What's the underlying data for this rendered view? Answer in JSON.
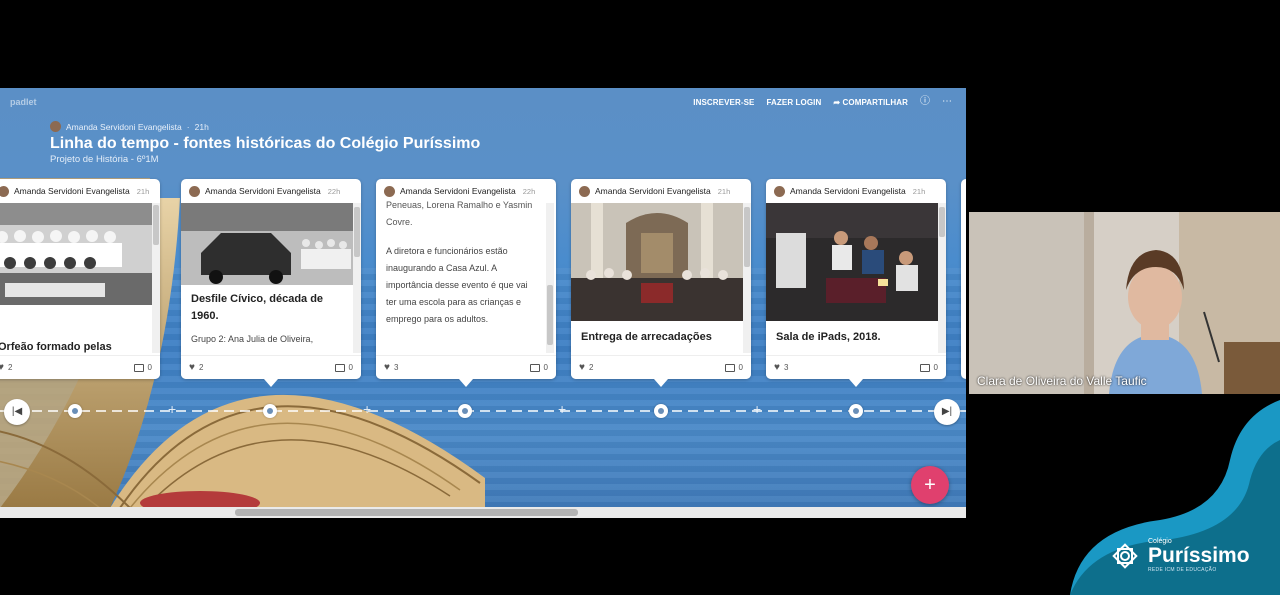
{
  "padlet": {
    "logo": "padlet",
    "nav": {
      "signup": "INSCREVER-SE",
      "login": "FAZER LOGIN",
      "share": "COMPARTILHAR"
    },
    "author": "Amanda Servidoni Evangelista",
    "age": "21h",
    "title": "Linha do tempo - fontes históricas do Colégio Puríssimo",
    "subtitle": "Projeto de História - 6º1M"
  },
  "cards": [
    {
      "author": "Amanda Servidoni Evangelista",
      "age": "21h",
      "title": "Orfeão formado pelas",
      "body": "",
      "likes": "2",
      "comments": "0"
    },
    {
      "author": "Amanda Servidoni Evangelista",
      "age": "22h",
      "title": "Desfile Cívico, década de 1960.",
      "body": "Grupo 2: Ana Julia de Oliveira,",
      "likes": "2",
      "comments": "0"
    },
    {
      "author": "Amanda Servidoni Evangelista",
      "age": "22h",
      "title": "",
      "body_top": "Peneuas, Lorena Ramalho e Yasmin Covre.",
      "body": "A diretora e funcionários estão inaugurando a Casa Azul. A importância desse evento é que vai ter uma escola para as crianças e emprego para os adultos.",
      "likes": "3",
      "comments": "0"
    },
    {
      "author": "Amanda Servidoni Evangelista",
      "age": "21h",
      "title": "Entrega de arrecadações com o Asilo São Vicente",
      "body": "",
      "likes": "2",
      "comments": "0"
    },
    {
      "author": "Amanda Servidoni Evangelista",
      "age": "21h",
      "title": "Sala de iPads, 2018.",
      "body": "",
      "likes": "3",
      "comments": "0"
    }
  ],
  "participant": {
    "name": "Clara de Oliveira do Valle Taufic"
  },
  "brand": {
    "small": "Colégio",
    "name": "Puríssimo",
    "tagline": "REDE ICM DE EDUCAÇÃO"
  },
  "colors": {
    "accent": "#e0406e",
    "brand": "#1590b8"
  },
  "icons": {
    "fab": "plus-icon",
    "prev": "first-page-icon",
    "next": "last-page-icon"
  }
}
